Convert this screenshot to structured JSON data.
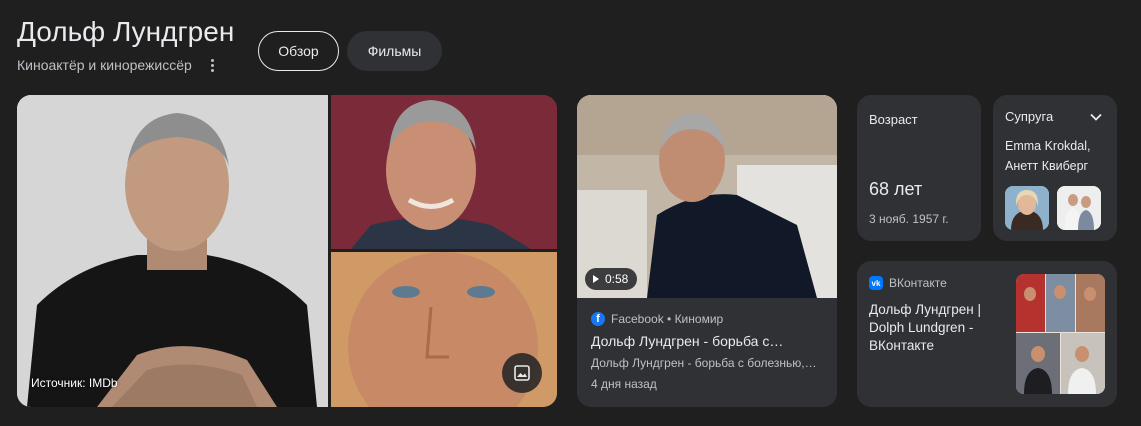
{
  "header": {
    "title": "Дольф Лундгрен",
    "subtitle": "Киноактёр и кинорежиссёр"
  },
  "tabs": [
    {
      "label": "Обзор",
      "selected": true
    },
    {
      "label": "Фильмы",
      "selected": false
    }
  ],
  "images": {
    "source_label": "Источник: IMDb"
  },
  "video": {
    "duration": "0:58",
    "source": "Facebook • Киномир",
    "title": "Дольф Лундгрен - борьба с…",
    "snippet": "Дольф Лундгрен - борьба с болезнью,…",
    "date": "4 дня назад"
  },
  "age": {
    "label": "Возраст",
    "value": "68 лет",
    "birth_date": "3 нояб. 1957 г."
  },
  "spouse": {
    "label": "Супруга",
    "name_1": "Emma Krokdal,",
    "name_2": "Анетт Квиберг"
  },
  "vk": {
    "source": "ВКонтакте",
    "title": "Дольф Лундгрен | Dolph Lundgren - ВКонтакте"
  },
  "colors": {
    "background": "#1f1f1f",
    "card": "#303134",
    "facebook": "#1877f2",
    "vk": "#0077ff"
  }
}
